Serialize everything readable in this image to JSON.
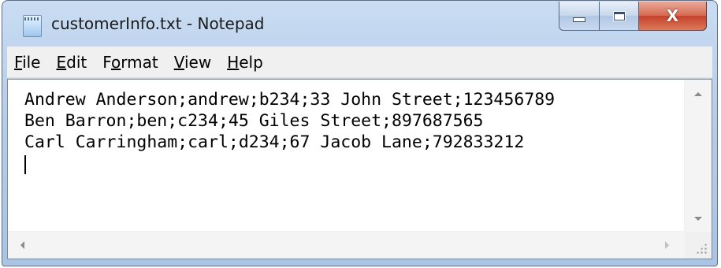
{
  "window": {
    "title": "customerInfo.txt - Notepad",
    "app_icon": "notepad-icon"
  },
  "caption_buttons": {
    "minimize_icon": "minimize-icon",
    "maximize_icon": "maximize-icon",
    "close_glyph": "X"
  },
  "menu": {
    "items": [
      {
        "accelerator": "F",
        "rest": "ile"
      },
      {
        "accelerator": "E",
        "rest": "dit"
      },
      {
        "pre": "F",
        "accelerator": "o",
        "rest": "rmat"
      },
      {
        "accelerator": "V",
        "rest": "iew"
      },
      {
        "accelerator": "H",
        "rest": "elp"
      }
    ]
  },
  "document": {
    "lines": [
      "Andrew Anderson;andrew;b234;33 John Street;123456789",
      "Ben Barron;ben;c234;45 Giles Street;897687565",
      "Carl Carringham;carl;d234;67 Jacob Lane;792833212"
    ]
  },
  "colors": {
    "titlebar": "#b9d1ea",
    "close_button": "#c94a30",
    "menubar": "#f0f0f0",
    "editor_bg": "#ffffff"
  }
}
